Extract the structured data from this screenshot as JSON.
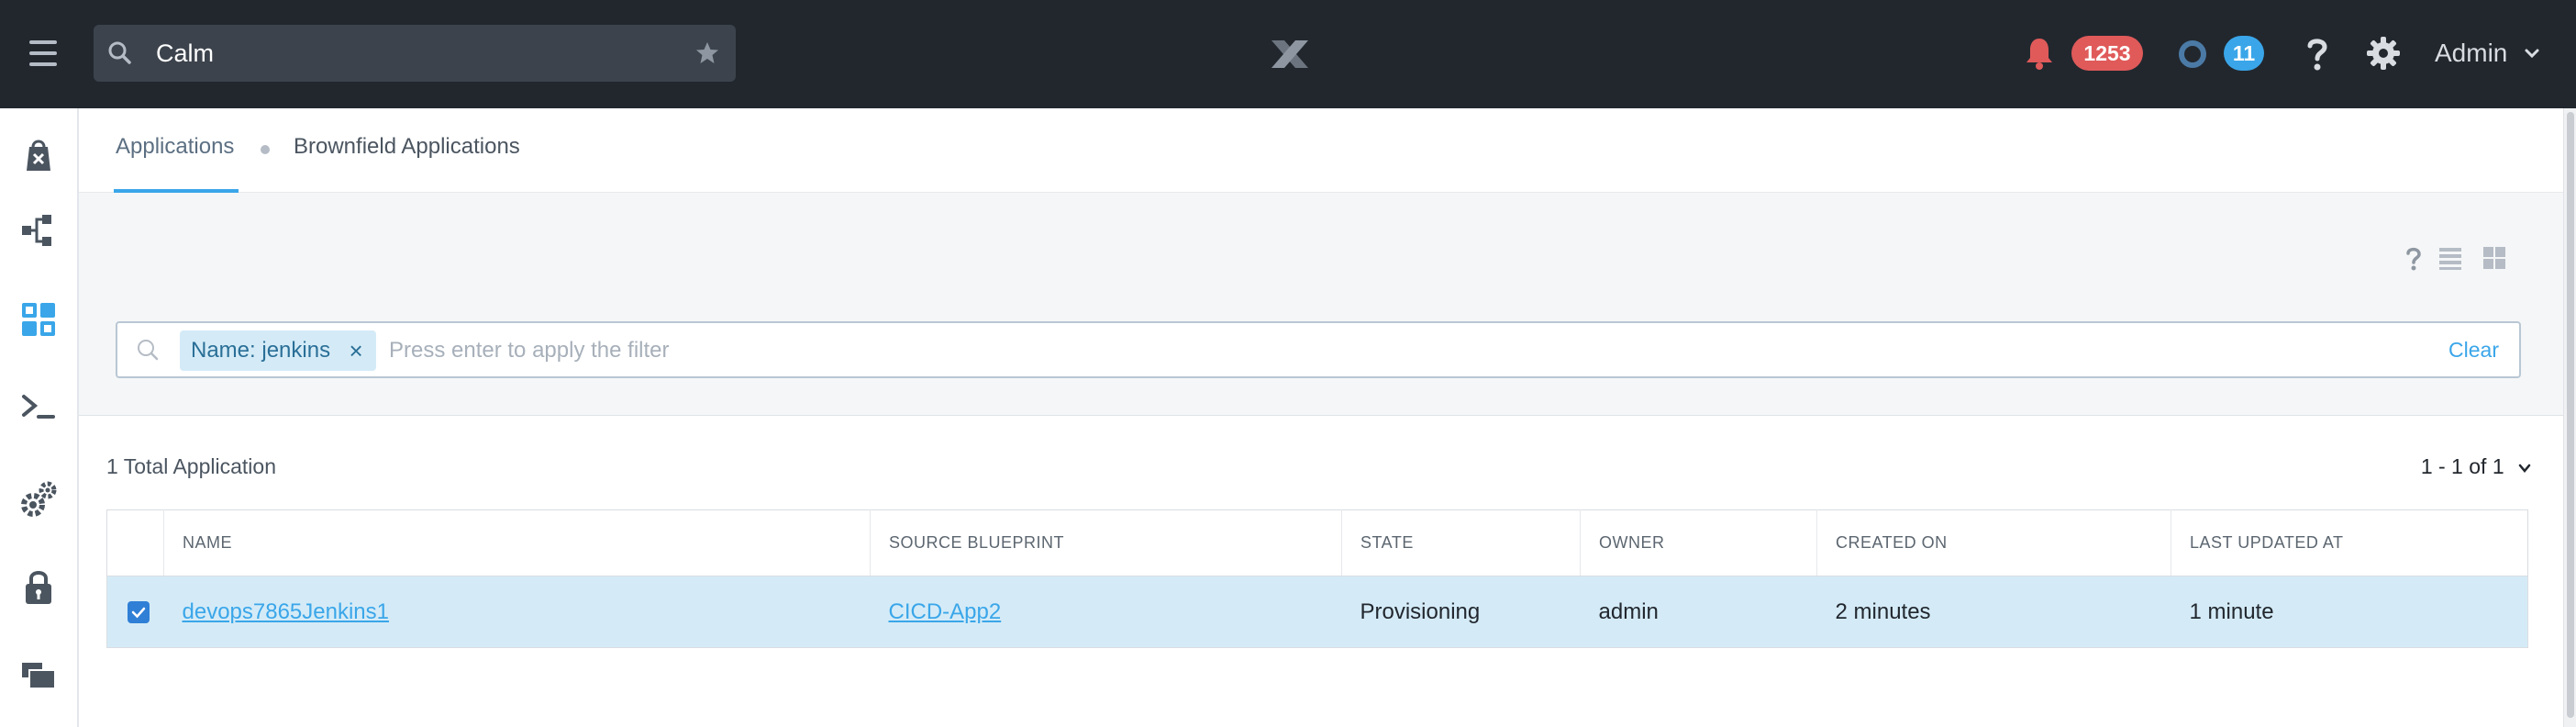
{
  "header": {
    "search_value": "Calm",
    "alerts_count": "1253",
    "tasks_count": "11",
    "user_label": "Admin"
  },
  "tabs": [
    {
      "label": "Applications",
      "active": true
    },
    {
      "label": "Brownfield Applications",
      "active": false
    }
  ],
  "filter": {
    "chip_label": "Name: jenkins",
    "chip_close": "×",
    "placeholder": "Press enter to apply the filter",
    "clear_label": "Clear"
  },
  "summary": {
    "total_label": "1 Total Application",
    "pagination": "1 - 1 of 1"
  },
  "table": {
    "columns": [
      "NAME",
      "SOURCE BLUEPRINT",
      "STATE",
      "OWNER",
      "CREATED ON",
      "LAST UPDATED AT"
    ],
    "rows": [
      {
        "selected": true,
        "name": "devops7865Jenkins1",
        "blueprint": "CICD-App2",
        "state": "Provisioning",
        "owner": "admin",
        "created_on": "2 minutes",
        "last_updated": "1 minute"
      }
    ]
  },
  "icons": {
    "sidebar": [
      "marketplace-icon",
      "blueprints-icon",
      "applications-icon",
      "runbooks-icon",
      "settings-icon",
      "policies-icon",
      "projects-icon"
    ],
    "view_toggles": [
      "help-icon",
      "list-view-icon",
      "grid-view-icon"
    ]
  },
  "colors": {
    "topbar": "#22272e",
    "accent": "#3aa6e9",
    "alert_badge": "#e05a5a",
    "selected_row": "#d4ebf7"
  }
}
